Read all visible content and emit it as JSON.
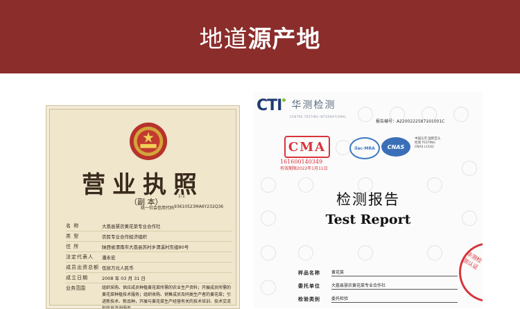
{
  "banner": {
    "title_light": "地道",
    "title_bold": "源产地",
    "background": "#8a2d2b"
  },
  "license": {
    "title": "营业执照",
    "copy_label": "（副 本）",
    "copy_no": "1-1",
    "credit_label": "统一社会信用代码",
    "credit_code": "93610523MA6Y232Q36",
    "rows": [
      {
        "label": "名 称",
        "value": "大荔县慧农黄花菜专业合作社"
      },
      {
        "label": "类 型",
        "value": "农民专业合作经济组织"
      },
      {
        "label": "住 所",
        "value": "陕西省渭南市大荔县苏村乡渭溪村东组80号"
      },
      {
        "label": "法定代表人",
        "value": "潘永宏"
      },
      {
        "label": "成员出资总额",
        "value": "伍拾万元人民币"
      },
      {
        "label": "成立日期",
        "value": "2008 年 03 月 31 日"
      }
    ],
    "scope_label": "业务范围",
    "scope_value": "组织采购、供应成员种植黄花菜所需的农业生产资料；开展成员所需的黄花菜种植技术服务；组织收购、销售成员及同类生产者的黄花菜；引进新技术、新品种，开展与黄花菜生产经营有关的技术培训、技术交流和信息咨询服务。"
  },
  "report": {
    "logo_text": "CTI",
    "logo_cn": "华测检测",
    "logo_sub": "CENTRE TESTING INTERNATIONAL",
    "report_no": "报告编号：A2200222587101001C",
    "cma_text": "CMA",
    "cma_no": "161600140349",
    "cma_valid": "有效期限2022年1月11日",
    "ilac_text": "ilac-MRA",
    "cnas_text": "CNAS",
    "cnas_note": "中国认可 国际互认 检测 TESTING CNAS L1162",
    "title_cn": "检测报告",
    "title_en": "Test Report",
    "fields": [
      {
        "label": "样品名称",
        "value": "黄花菜"
      },
      {
        "label": "委托单位",
        "value": "大荔县慧农黄花菜专业合作社"
      },
      {
        "label": "检验类别",
        "value": "委托检验"
      }
    ],
    "seal_text": "华测检测认证"
  }
}
